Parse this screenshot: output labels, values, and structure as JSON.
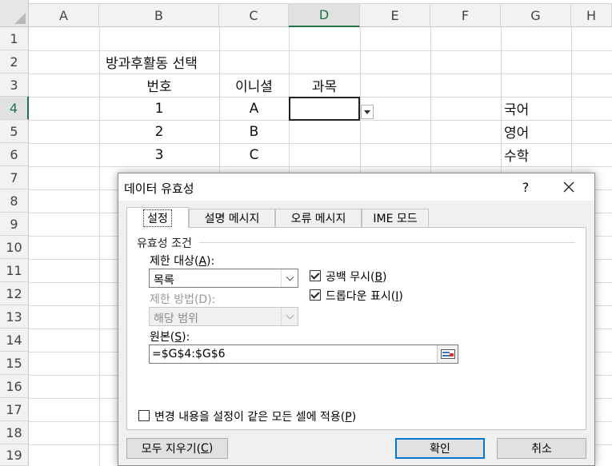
{
  "sheet": {
    "columns": [
      "A",
      "B",
      "C",
      "D",
      "E",
      "F",
      "G",
      "H"
    ],
    "rows": [
      "1",
      "2",
      "3",
      "4",
      "5",
      "6",
      "7",
      "8",
      "9",
      "10",
      "11",
      "12",
      "13",
      "14",
      "15",
      "16",
      "17",
      "18",
      "19"
    ],
    "active_column": "D",
    "active_row": "4",
    "cells": {
      "b2": "방과후활동 선택",
      "b3": "번호",
      "c3": "이니셜",
      "d3": "과목",
      "b4": "1",
      "c4": "A",
      "b5": "2",
      "c5": "B",
      "b6": "3",
      "c6": "C",
      "g4": "국어",
      "g5": "영어",
      "g6": "수학"
    }
  },
  "dialog": {
    "title": "데이터 유효성",
    "help": "?",
    "tabs": [
      "설정",
      "설명 메시지",
      "오류 메시지",
      "IME 모드"
    ],
    "active_tab": "설정",
    "group_title": "유효성 조건",
    "allow_label": "제한 대상(",
    "allow_key": "A",
    "allow_value": "목록",
    "data_label": "제한 방법(D):",
    "data_value": "해당 범위",
    "ignore_blank_label": "공백 무시(",
    "ignore_blank_key": "B",
    "ignore_blank_checked": true,
    "dropdown_label": "드롭다운 표시(",
    "dropdown_key": "I",
    "dropdown_checked": true,
    "source_label": "원본(",
    "source_key": "S",
    "source_value": "=$G$4:$G$6",
    "apply_all_label": "변경 내용을 설정이 같은 모든 셀에 적용(",
    "apply_all_key": "P",
    "apply_all_checked": false,
    "clear_all_label": "모두 지우기(",
    "clear_all_key": "C",
    "ok_label": "확인",
    "cancel_label": "취소"
  },
  "colors": {
    "accent": "#217346",
    "focus": "#0078d7"
  }
}
